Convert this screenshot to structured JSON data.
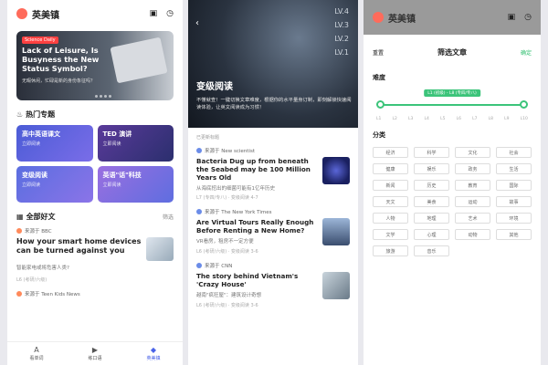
{
  "app": {
    "title": "英美镇"
  },
  "p1": {
    "banner": {
      "tag": "Science Daily",
      "title": "Lack of Leisure, Is Busyness the New Status Symbol?",
      "subtitle": "无暇休闲，忙碌是新的身份象征吗？"
    },
    "topics_title": "热门专题",
    "topics": [
      {
        "name": "高中英语课文",
        "button": "立即阅读"
      },
      {
        "name": "TED 演讲",
        "button": "立即阅读"
      },
      {
        "name": "变级阅读",
        "button": "立即阅读"
      },
      {
        "name": "英语\"话\"科技",
        "button": "立即阅读"
      }
    ],
    "all_title": "全部好文",
    "filter": "筛选",
    "article": {
      "source": "来源于 BBC",
      "title": "How your smart home devices can be turned against you",
      "cn": "智能家电或将危害人类?",
      "meta": "L6 (考研/六级)"
    },
    "article2_source": "来源于 Teen Kids News",
    "tabs": [
      {
        "label": "看单词",
        "icon": "A"
      },
      {
        "label": "练口语",
        "icon": "▶"
      },
      {
        "label": "英美镇",
        "icon": "◆"
      }
    ]
  },
  "p2": {
    "back": "‹",
    "gauge": [
      "LV.4",
      "LV.3",
      "LV.2",
      "LV.1"
    ],
    "title": "变级阅读",
    "desc": "不懂就查！一键切换文章难度，根据你的水平量身订制，即刻解锁快速阅读体验，让英文阅读成为习惯！",
    "selected": "已更新标题",
    "items": [
      {
        "source": "来源于 New scientist",
        "title": "Bacteria Dug up from beneath the Seabed may be 100 Million Years Old",
        "cn": "从海底挖出的细菌可能有1亿年历史",
        "meta": "L7 (专四/专八)  · 变级阅读 4-7"
      },
      {
        "source": "来源于 The New York Times",
        "title": "Are Virtual Tours Really Enough Before Renting a New Home?",
        "cn": "VR看房，租房不一定方便",
        "meta": "L6 (考研/六级)  · 变级阅读 3-6"
      },
      {
        "source": "来源于 CNN",
        "title": "The story behind Vietnam's 'Crazy House'",
        "cn": "越南\"疯狂屋\"：建筑设计奇想",
        "meta": "L6 (考研/六级)  · 变级阅读 3-6"
      }
    ]
  },
  "p3": {
    "reset": "重置",
    "title": "筛选文章",
    "confirm": "确定",
    "difficulty_label": "难度",
    "slider_bubble": "L1 (初级) - L8 (专四/专八)",
    "ticks": [
      "L1",
      "L2",
      "L3",
      "L4",
      "L5",
      "L6",
      "L7",
      "L8",
      "L9",
      "L10"
    ],
    "category_label": "分类",
    "categories": [
      "经济",
      "科学",
      "文化",
      "社会",
      "健康",
      "娱乐",
      "政务",
      "生活",
      "新闻",
      "历史",
      "教育",
      "国际",
      "天文",
      "美食",
      "运动",
      "故事",
      "人物",
      "地理",
      "艺术",
      "环境",
      "文学",
      "心理",
      "动物",
      "其他",
      "旅游",
      "音乐"
    ]
  }
}
